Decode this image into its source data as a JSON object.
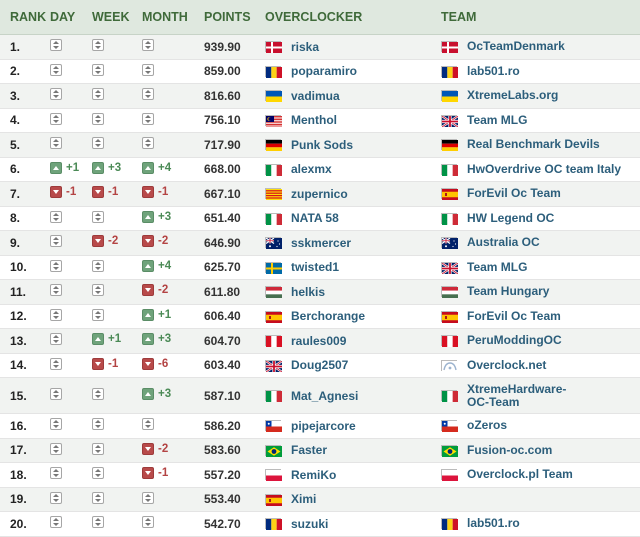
{
  "headers": {
    "rank": "RANK",
    "day": "DAY",
    "week": "WEEK",
    "month": "MONTH",
    "points": "POINTS",
    "overclocker": "OVERCLOCKER",
    "team": "TEAM"
  },
  "rows": [
    {
      "rank": "1.",
      "day": {
        "dir": "neutral",
        "val": ""
      },
      "week": {
        "dir": "neutral",
        "val": ""
      },
      "month": {
        "dir": "neutral",
        "val": ""
      },
      "points": "939.90",
      "name": "riska",
      "flag": "denmark-flag",
      "team": "OcTeamDenmark",
      "team_flag": "denmark-flag"
    },
    {
      "rank": "2.",
      "day": {
        "dir": "neutral",
        "val": ""
      },
      "week": {
        "dir": "neutral",
        "val": ""
      },
      "month": {
        "dir": "neutral",
        "val": ""
      },
      "points": "859.00",
      "name": "poparamiro",
      "flag": "romania-flag",
      "team": "lab501.ro",
      "team_flag": "romania-flag"
    },
    {
      "rank": "3.",
      "day": {
        "dir": "neutral",
        "val": ""
      },
      "week": {
        "dir": "neutral",
        "val": ""
      },
      "month": {
        "dir": "neutral",
        "val": ""
      },
      "points": "816.60",
      "name": "vadimua",
      "flag": "ukraine-flag",
      "team": "XtremeLabs.org",
      "team_flag": "ukraine-flag"
    },
    {
      "rank": "4.",
      "day": {
        "dir": "neutral",
        "val": ""
      },
      "week": {
        "dir": "neutral",
        "val": ""
      },
      "month": {
        "dir": "neutral",
        "val": ""
      },
      "points": "756.10",
      "name": "Menthol",
      "flag": "malaysia-flag",
      "team": "Team MLG",
      "team_flag": "uk-flag"
    },
    {
      "rank": "5.",
      "day": {
        "dir": "neutral",
        "val": ""
      },
      "week": {
        "dir": "neutral",
        "val": ""
      },
      "month": {
        "dir": "neutral",
        "val": ""
      },
      "points": "717.90",
      "name": "Punk Sods",
      "flag": "germany-flag",
      "team": "Real Benchmark Devils",
      "team_flag": "germany-flag"
    },
    {
      "rank": "6.",
      "day": {
        "dir": "up",
        "val": "+1"
      },
      "week": {
        "dir": "up",
        "val": "+3"
      },
      "month": {
        "dir": "up",
        "val": "+4"
      },
      "points": "668.00",
      "name": "alexmx",
      "flag": "italy-flag",
      "team": "HwOverdrive OC team Italy",
      "team_flag": "italy-flag"
    },
    {
      "rank": "7.",
      "day": {
        "dir": "down",
        "val": "-1"
      },
      "week": {
        "dir": "down",
        "val": "-1"
      },
      "month": {
        "dir": "down",
        "val": "-1"
      },
      "points": "667.10",
      "name": "zupernico",
      "flag": "catalonia-flag",
      "team": "ForEvil Oc Team",
      "team_flag": "spain-flag"
    },
    {
      "rank": "8.",
      "day": {
        "dir": "neutral",
        "val": ""
      },
      "week": {
        "dir": "neutral",
        "val": ""
      },
      "month": {
        "dir": "up",
        "val": "+3"
      },
      "points": "651.40",
      "name": "NATA 58",
      "flag": "italy-flag",
      "team": "HW Legend OC",
      "team_flag": "italy-flag"
    },
    {
      "rank": "9.",
      "day": {
        "dir": "neutral",
        "val": ""
      },
      "week": {
        "dir": "down",
        "val": "-2"
      },
      "month": {
        "dir": "down",
        "val": "-2"
      },
      "points": "646.90",
      "name": "sskmercer",
      "flag": "australia-flag",
      "team": "Australia OC",
      "team_flag": "australia-flag"
    },
    {
      "rank": "10.",
      "day": {
        "dir": "neutral",
        "val": ""
      },
      "week": {
        "dir": "neutral",
        "val": ""
      },
      "month": {
        "dir": "up",
        "val": "+4"
      },
      "points": "625.70",
      "name": "twisted1",
      "flag": "sweden-flag",
      "team": "Team MLG",
      "team_flag": "uk-flag"
    },
    {
      "rank": "11.",
      "day": {
        "dir": "neutral",
        "val": ""
      },
      "week": {
        "dir": "neutral",
        "val": ""
      },
      "month": {
        "dir": "down",
        "val": "-2"
      },
      "points": "611.80",
      "name": "helkis",
      "flag": "hungary-flag",
      "team": "Team Hungary",
      "team_flag": "hungary-flag"
    },
    {
      "rank": "12.",
      "day": {
        "dir": "neutral",
        "val": ""
      },
      "week": {
        "dir": "neutral",
        "val": ""
      },
      "month": {
        "dir": "up",
        "val": "+1"
      },
      "points": "606.40",
      "name": "Berchorange",
      "flag": "spain-flag",
      "team": "ForEvil Oc Team",
      "team_flag": "spain-flag"
    },
    {
      "rank": "13.",
      "day": {
        "dir": "neutral",
        "val": ""
      },
      "week": {
        "dir": "up",
        "val": "+1"
      },
      "month": {
        "dir": "up",
        "val": "+3"
      },
      "points": "604.70",
      "name": "raules009",
      "flag": "peru-flag",
      "team": "PeruModdingOC",
      "team_flag": "peru-flag"
    },
    {
      "rank": "14.",
      "day": {
        "dir": "neutral",
        "val": ""
      },
      "week": {
        "dir": "down",
        "val": "-1"
      },
      "month": {
        "dir": "down",
        "val": "-6"
      },
      "points": "603.40",
      "name": "Doug2507",
      "flag": "uk-flag",
      "team": "Overclock.net",
      "team_flag": "overclocknet-logo"
    },
    {
      "rank": "15.",
      "day": {
        "dir": "neutral",
        "val": ""
      },
      "week": {
        "dir": "neutral",
        "val": ""
      },
      "month": {
        "dir": "up",
        "val": "+3"
      },
      "points": "587.10",
      "name": "Mat_Agnesi",
      "flag": "italy-flag",
      "team": "XtremeHardware-OC-Team",
      "team_flag": "italy-flag",
      "tall": true
    },
    {
      "rank": "16.",
      "day": {
        "dir": "neutral",
        "val": ""
      },
      "week": {
        "dir": "neutral",
        "val": ""
      },
      "month": {
        "dir": "neutral",
        "val": ""
      },
      "points": "586.20",
      "name": "pipejarcore",
      "flag": "chile-flag",
      "team": "oZeros",
      "team_flag": "chile-flag"
    },
    {
      "rank": "17.",
      "day": {
        "dir": "neutral",
        "val": ""
      },
      "week": {
        "dir": "neutral",
        "val": ""
      },
      "month": {
        "dir": "down",
        "val": "-2"
      },
      "points": "583.60",
      "name": "Faster",
      "flag": "brazil-flag",
      "team": "Fusion-oc.com",
      "team_flag": "brazil-flag"
    },
    {
      "rank": "18.",
      "day": {
        "dir": "neutral",
        "val": ""
      },
      "week": {
        "dir": "neutral",
        "val": ""
      },
      "month": {
        "dir": "down",
        "val": "-1"
      },
      "points": "557.20",
      "name": "RemiKo",
      "flag": "poland-flag",
      "team": "Overclock.pl Team",
      "team_flag": "poland-flag"
    },
    {
      "rank": "19.",
      "day": {
        "dir": "neutral",
        "val": ""
      },
      "week": {
        "dir": "neutral",
        "val": ""
      },
      "month": {
        "dir": "neutral",
        "val": ""
      },
      "points": "553.40",
      "name": "Ximi",
      "flag": "spain-flag",
      "team": "",
      "team_flag": ""
    },
    {
      "rank": "20.",
      "day": {
        "dir": "neutral",
        "val": ""
      },
      "week": {
        "dir": "neutral",
        "val": ""
      },
      "month": {
        "dir": "neutral",
        "val": ""
      },
      "points": "542.70",
      "name": "suzuki",
      "flag": "romania-flag",
      "team": "lab501.ro",
      "team_flag": "romania-flag"
    }
  ],
  "colors": {
    "header_bg": "#dfe8df",
    "header_text": "#3f6a3a",
    "link": "#2c5e7b",
    "up": "#6fa37b",
    "down": "#b84a4a"
  }
}
